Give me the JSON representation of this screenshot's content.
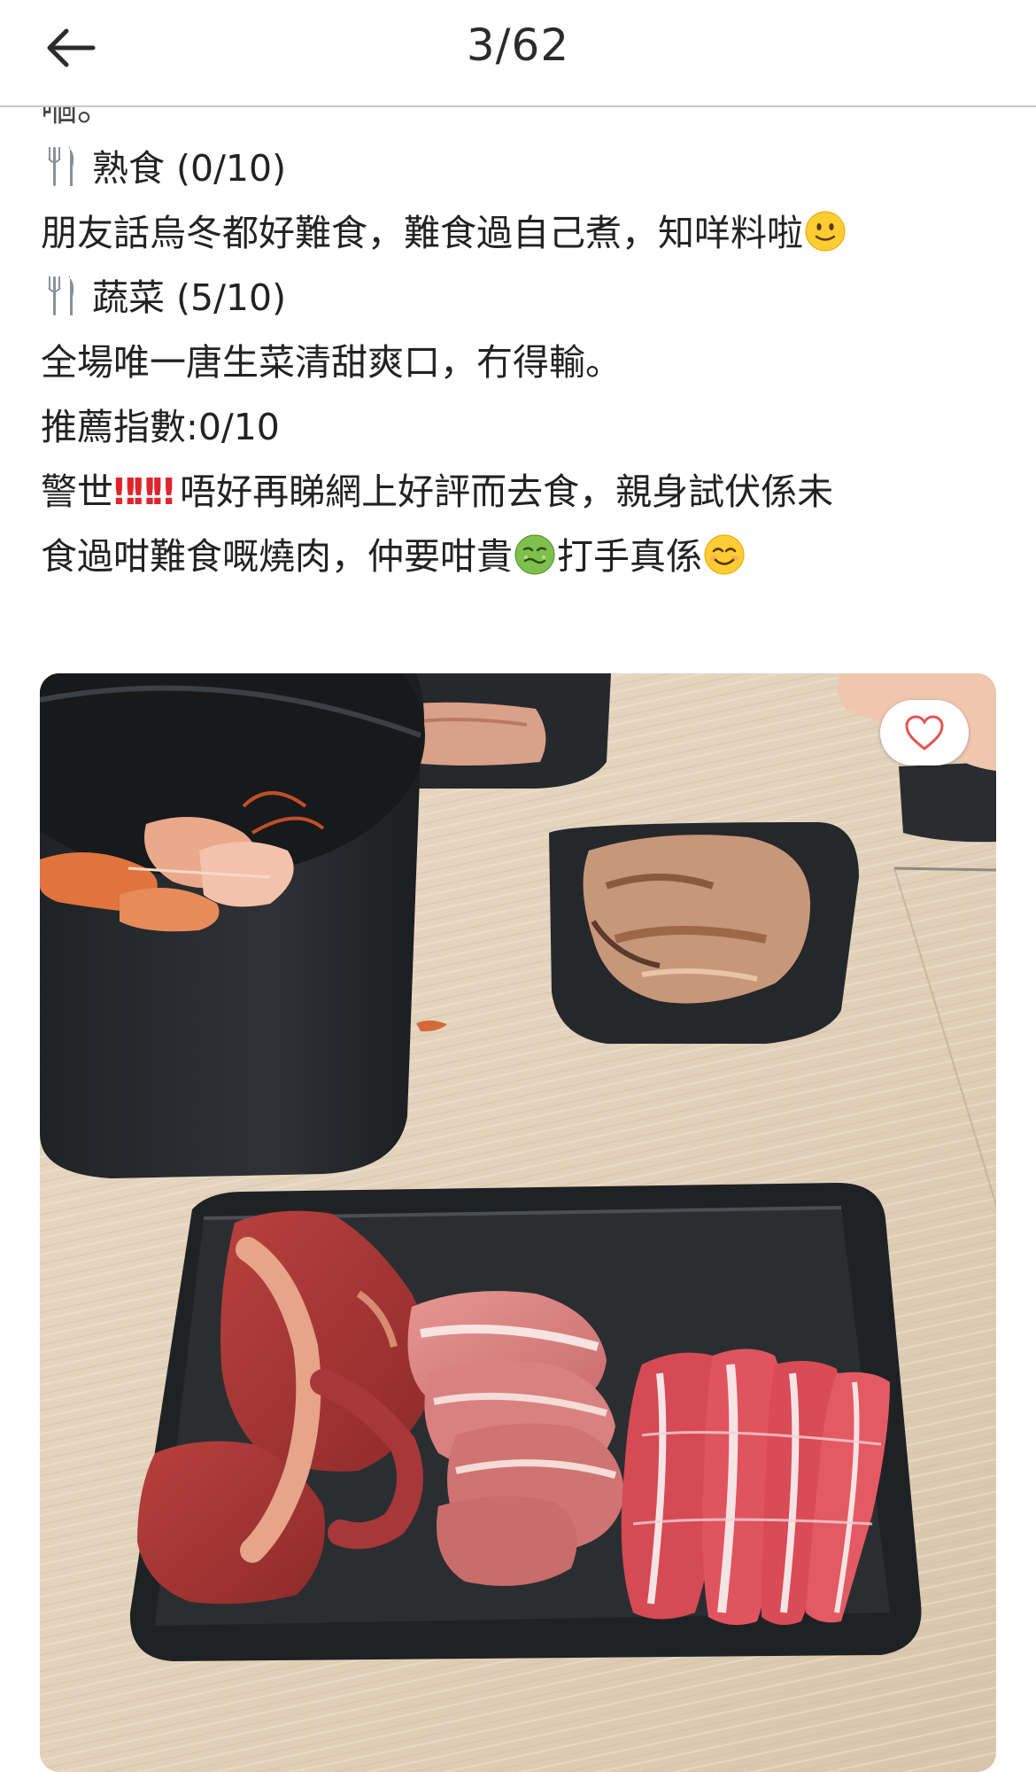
{
  "header": {
    "counter": "3/62",
    "back_icon": "back-arrow-icon"
  },
  "post": {
    "cut_line": "嗰。",
    "lines": [
      {
        "icon": "fork-knife-icon",
        "text": "熟食 (0/10)"
      },
      {
        "text": "朋友話烏冬都好難食，難食過自己煮，知咩料啦",
        "trailing_emoji": "slightly-smiling-face-icon"
      },
      {
        "icon": "fork-knife-icon",
        "text": "蔬菜 (5/10)"
      },
      {
        "text": "全場唯一唐生菜清甜爽口，冇得輸。"
      },
      {
        "text": "推薦指數:0/10"
      },
      {
        "text_a": "警世",
        "bang": "‼‼‼",
        "text_b": "唔好再睇網上好評而去食，親身試伏係未"
      },
      {
        "text_a": "食過咁難食嘅燒肉，仲要咁貴",
        "text_b": "打手真係",
        "emojis": [
          "nauseated-face-icon",
          "smiling-face-icon"
        ]
      }
    ]
  },
  "photo": {
    "description_icon": "bbq-meat-photo",
    "like_icon": "heart-outline-icon"
  },
  "colors": {
    "accent_red": "#e0242c",
    "divider": "#c9c9c9",
    "heart": "#e55353"
  }
}
